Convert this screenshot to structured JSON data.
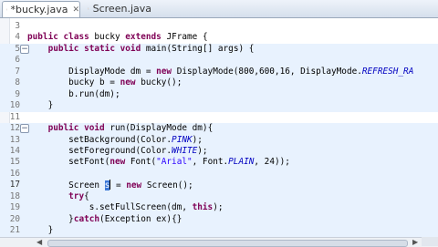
{
  "tabs": [
    {
      "label": "*bucky.java",
      "icon": "java-file-icon",
      "active": true
    },
    {
      "label": "Screen.java",
      "icon": "java-file-icon",
      "active": false
    }
  ],
  "colors": {
    "keyword": "#7f0055",
    "string": "#2a00ff",
    "constant": "#0000c0",
    "line_highlight": "#e8f2fe",
    "selection": "#3c78d8"
  },
  "editor": {
    "lines": [
      {
        "num": "3",
        "tokens": []
      },
      {
        "num": "4",
        "tokens": [
          {
            "t": "public",
            "k": "kw"
          },
          {
            "t": " "
          },
          {
            "t": "class",
            "k": "kw"
          },
          {
            "t": " bucky "
          },
          {
            "t": "extends",
            "k": "kw"
          },
          {
            "t": " JFrame {"
          }
        ]
      },
      {
        "num": "5",
        "tokens": [
          {
            "t": "    "
          },
          {
            "t": "public",
            "k": "kw"
          },
          {
            "t": " "
          },
          {
            "t": "static",
            "k": "kw"
          },
          {
            "t": " "
          },
          {
            "t": "void",
            "k": "kw"
          },
          {
            "t": " main(String[] args) {"
          }
        ]
      },
      {
        "num": "6",
        "tokens": []
      },
      {
        "num": "7",
        "tokens": [
          {
            "t": "        DisplayMode dm = "
          },
          {
            "t": "new",
            "k": "kw"
          },
          {
            "t": " DisplayMode(800,600,16, DisplayMode."
          },
          {
            "t": "REFRESH_RA",
            "k": "it"
          }
        ]
      },
      {
        "num": "8",
        "tokens": [
          {
            "t": "        bucky b = "
          },
          {
            "t": "new",
            "k": "kw"
          },
          {
            "t": " bucky();"
          }
        ]
      },
      {
        "num": "9",
        "tokens": [
          {
            "t": "        b.run(dm);"
          }
        ]
      },
      {
        "num": "10",
        "tokens": [
          {
            "t": "    }"
          }
        ]
      },
      {
        "num": "11",
        "tokens": []
      },
      {
        "num": "12",
        "tokens": [
          {
            "t": "    "
          },
          {
            "t": "public",
            "k": "kw"
          },
          {
            "t": " "
          },
          {
            "t": "void",
            "k": "kw"
          },
          {
            "t": " run(DisplayMode dm){"
          }
        ]
      },
      {
        "num": "13",
        "tokens": [
          {
            "t": "        setBackground(Color."
          },
          {
            "t": "PINK",
            "k": "it"
          },
          {
            "t": ");"
          }
        ]
      },
      {
        "num": "14",
        "tokens": [
          {
            "t": "        setForeground(Color."
          },
          {
            "t": "WHITE",
            "k": "it"
          },
          {
            "t": ");"
          }
        ]
      },
      {
        "num": "15",
        "tokens": [
          {
            "t": "        setFont("
          },
          {
            "t": "new",
            "k": "kw"
          },
          {
            "t": " Font("
          },
          {
            "t": "\"Arial\"",
            "k": "str"
          },
          {
            "t": ", Font."
          },
          {
            "t": "PLAIN",
            "k": "it"
          },
          {
            "t": ", 24));"
          }
        ]
      },
      {
        "num": "16",
        "tokens": []
      },
      {
        "num": "17",
        "tokens": [
          {
            "t": "        Screen "
          },
          {
            "t": "s",
            "k": "sel"
          },
          {
            "t": "",
            "k": "cursor"
          },
          {
            "t": " = "
          },
          {
            "t": "new",
            "k": "kw"
          },
          {
            "t": " Screen();"
          }
        ]
      },
      {
        "num": "18",
        "tokens": [
          {
            "t": "        "
          },
          {
            "t": "try",
            "k": "kw"
          },
          {
            "t": "{"
          }
        ]
      },
      {
        "num": "19",
        "tokens": [
          {
            "t": "            s.setFullScreen(dm, "
          },
          {
            "t": "this",
            "k": "kw"
          },
          {
            "t": ");"
          }
        ]
      },
      {
        "num": "20",
        "tokens": [
          {
            "t": "        }"
          },
          {
            "t": "catch",
            "k": "kw"
          },
          {
            "t": "(Exception ex){}"
          }
        ]
      },
      {
        "num": "21",
        "tokens": [
          {
            "t": "    }"
          }
        ]
      }
    ],
    "highlighted_lines": [
      "5",
      "6",
      "7",
      "8",
      "9",
      "10",
      "12",
      "13",
      "14",
      "15",
      "16",
      "17",
      "18",
      "19",
      "20",
      "21"
    ],
    "current_line": "17",
    "fold_lines": [
      "5",
      "12"
    ]
  }
}
